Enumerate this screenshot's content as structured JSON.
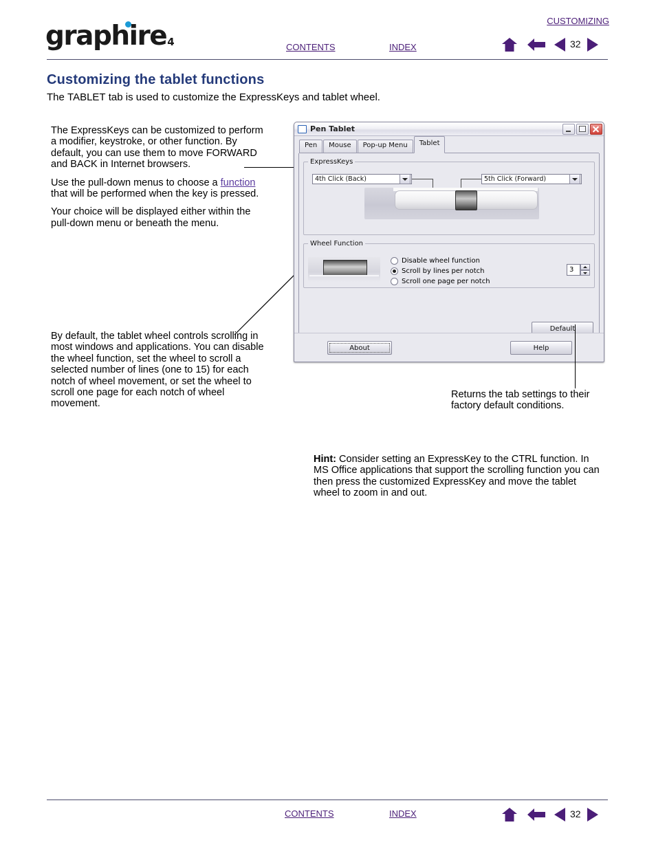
{
  "header": {
    "logo_text": "graphire",
    "logo_sub": "4",
    "topic": "CUSTOMIZING",
    "contents_label": "CONTENTS",
    "index_label": "INDEX",
    "page_number": "32",
    "icons": {
      "home": "home-icon",
      "back": "back-arrow-icon",
      "prev": "previous-page-icon",
      "next": "next-page-icon"
    }
  },
  "page": {
    "title": "Customizing the tablet functions",
    "subtitle_before": "The ",
    "subtitle_smallcaps": "TABLET",
    "subtitle_after": " tab is used to customize the ExpressKeys and tablet wheel."
  },
  "callouts": {
    "expresskeys": {
      "p1_a": "The ExpressKeys can be customized to perform a modifier, keystroke, or other function.  By default, you can use them to move ",
      "p1_sc1": "FORWARD",
      "p1_b": " and ",
      "p1_sc2": "BACK",
      "p1_c": " in Internet browsers.",
      "p2_a": "Use the pull-down menus to choose a ",
      "p2_link": "function",
      "p2_b": " that will be performed when the key is pressed.",
      "p3": "Your choice will be displayed either within the pull-down menu or beneath the menu."
    },
    "wheel": {
      "text": "By default, the tablet wheel controls scrolling in most windows and applications. You can disable the wheel function, set the wheel to scroll a selected number of lines (one to 15) for each notch of wheel movement, or set the wheel to scroll one page for each notch of wheel movement."
    },
    "default_button": {
      "text": "Returns the tab settings to their factory default conditions."
    },
    "hint": {
      "label": "Hint:",
      "a": " Consider setting an ExpressKey to the ",
      "sc": "CTRL",
      "b": " function. In MS Office applications that support the scrolling function you can then press the customized ExpressKey and move the tablet wheel to zoom in and out."
    }
  },
  "dialog": {
    "title": "Pen Tablet",
    "window_buttons": {
      "minimize": "minimize-icon",
      "maximize": "maximize-icon",
      "close": "close-icon"
    },
    "tabs": [
      {
        "label": "Pen",
        "active": false
      },
      {
        "label": "Mouse",
        "active": false
      },
      {
        "label": "Pop-up Menu",
        "active": false
      },
      {
        "label": "Tablet",
        "active": true
      }
    ],
    "expresskeys_group": {
      "legend": "ExpressKeys",
      "left_combo_value": "4th Click (Back)",
      "right_combo_value": "5th Click (Forward)"
    },
    "wheel_group": {
      "legend": "Wheel Function",
      "options": [
        {
          "label": "Disable wheel function",
          "selected": false
        },
        {
          "label": "Scroll by lines per notch",
          "selected": true
        },
        {
          "label": "Scroll one page per notch",
          "selected": false
        }
      ],
      "lines_value": "3"
    },
    "buttons": {
      "default": "Default",
      "about": "About",
      "help": "Help"
    }
  },
  "footer": {
    "contents_label": "CONTENTS",
    "index_label": "INDEX",
    "page_number": "32"
  },
  "colors": {
    "link_purple": "#4b1e78",
    "title_blue": "#243a7a",
    "logo_dot_blue": "#1b9ad6",
    "nav_purple": "#4b1e78"
  }
}
